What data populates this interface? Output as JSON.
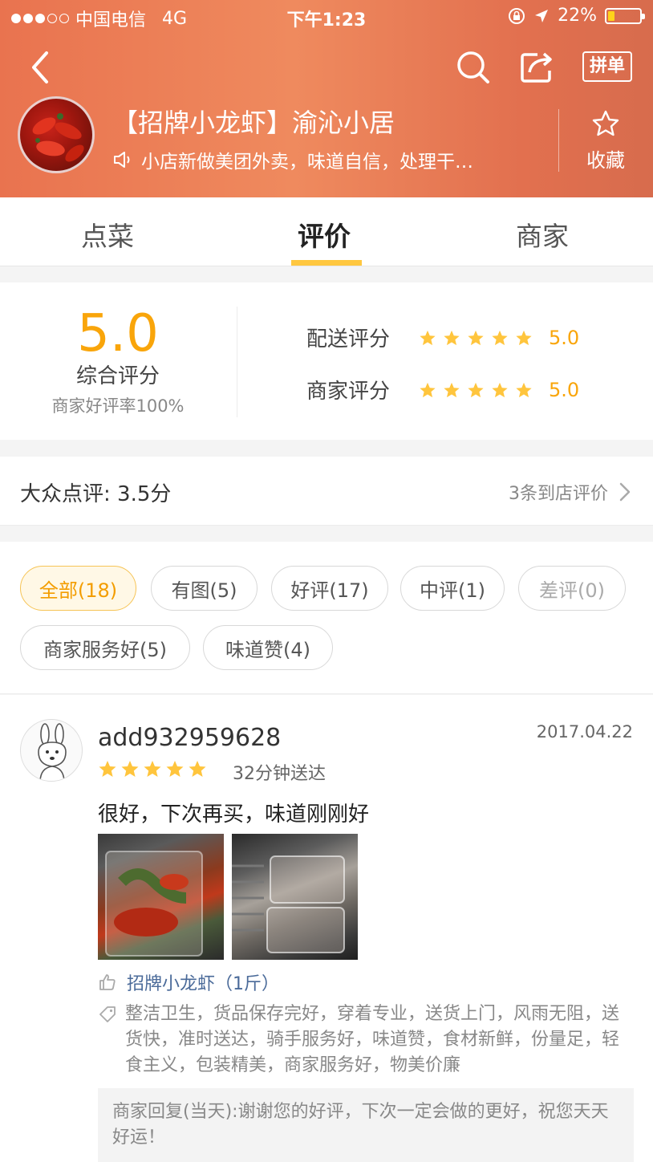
{
  "status_bar": {
    "carrier": "中国电信",
    "network": "4G",
    "time": "下午1:23",
    "battery": "22%",
    "battery_level": 0.22
  },
  "nav": {
    "pindan_label": "拼单"
  },
  "shop": {
    "name": "【招牌小龙虾】渝沁小居",
    "notice": "小店新做美团外卖，味道自信，处理干…",
    "fav_label": "收藏"
  },
  "tabs": [
    {
      "label": "点菜",
      "active": false
    },
    {
      "label": "评价",
      "active": true
    },
    {
      "label": "商家",
      "active": false
    }
  ],
  "rating": {
    "overall": "5.0",
    "overall_label": "综合评分",
    "praise_rate": "商家好评率100%",
    "rows": [
      {
        "label": "配送评分",
        "value": "5.0",
        "stars": 5
      },
      {
        "label": "商家评分",
        "value": "5.0",
        "stars": 5
      }
    ]
  },
  "dianping": {
    "label": "大众点评: 3.5分",
    "link": "3条到店评价"
  },
  "filters": [
    {
      "label": "全部(18)",
      "state": "active"
    },
    {
      "label": "有图(5)",
      "state": "normal"
    },
    {
      "label": "好评(17)",
      "state": "normal"
    },
    {
      "label": "中评(1)",
      "state": "normal"
    },
    {
      "label": "差评(0)",
      "state": "disabled"
    },
    {
      "label": "商家服务好(5)",
      "state": "normal"
    },
    {
      "label": "味道赞(4)",
      "state": "normal"
    }
  ],
  "review": {
    "username": "add932959628",
    "date": "2017.04.22",
    "stars": 5,
    "delivery_time": "32分钟送达",
    "text": "很好，下次再买，味道刚刚好",
    "dish": "招牌小龙虾（1斤）",
    "tags": "整洁卫生，货品保存完好，穿着专业，送货上门，风雨无阻，送货快，准时送达，骑手服务好，味道赞，食材新鲜，份量足，轻食主义，包装精美，商家服务好，物美价廉",
    "reply": "商家回复(当天):谢谢您的好评，下次一定会做的更好，祝您天天好运！"
  },
  "colors": {
    "accent": "#f9a50a",
    "tab_indicator": "#ffc740",
    "header": "#ec7d58",
    "link_blue": "#4a6a99"
  }
}
